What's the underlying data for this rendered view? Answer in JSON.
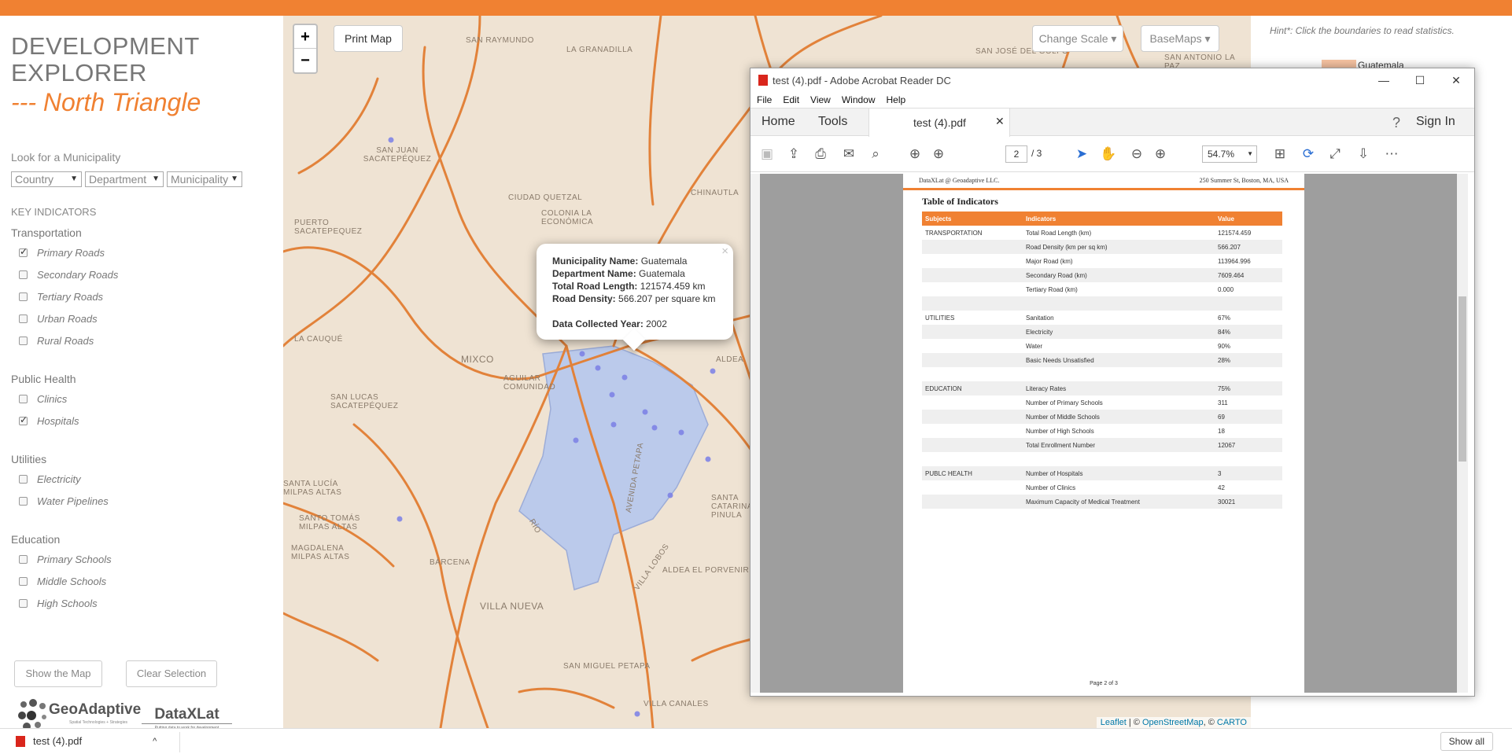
{
  "sidebar": {
    "title_line1": "DEVELOPMENT",
    "title_line2": "EXPLORER",
    "subtitle": "--- North Triangle",
    "search_label": "Look for a Municipality",
    "selects": [
      "Country",
      "Department",
      "Municipality"
    ],
    "key_indicators": "KEY INDICATORS",
    "sections": [
      {
        "title": "Transportation",
        "items": [
          {
            "label": "Primary Roads",
            "checked": true
          },
          {
            "label": "Secondary Roads",
            "checked": false
          },
          {
            "label": "Tertiary Roads",
            "checked": false
          },
          {
            "label": "Urban Roads",
            "checked": false
          },
          {
            "label": "Rural Roads",
            "checked": false
          }
        ]
      },
      {
        "title": "Public Health",
        "items": [
          {
            "label": "Clinics",
            "checked": false
          },
          {
            "label": "Hospitals",
            "checked": true
          }
        ]
      },
      {
        "title": "Utilities",
        "items": [
          {
            "label": "Electricity",
            "checked": false
          },
          {
            "label": "Water Pipelines",
            "checked": false
          }
        ]
      },
      {
        "title": "Education",
        "items": [
          {
            "label": "Primary Schools",
            "checked": false
          },
          {
            "label": "Middle Schools",
            "checked": false
          },
          {
            "label": "High Schools",
            "checked": false
          }
        ]
      }
    ],
    "show_map": "Show the Map",
    "clear_selection": "Clear Selection",
    "logo_geo": "GeoAdaptive",
    "logo_geo_tag": "Spatial Technologies + Strategies",
    "logo_dx": "DataXLat",
    "logo_dx_tag": "Putting data to work for development"
  },
  "map": {
    "zoom_in": "+",
    "zoom_out": "−",
    "print": "Print Map",
    "change_scale": "Change Scale ▾",
    "basemaps": "BaseMaps ▾",
    "labels": [
      "SAN RAYMUNDO",
      "LA GRANADILLA",
      "SAN JOSÉ DEL GOLFO",
      "SAN ANTONIO LA PAZ",
      "SAN JUAN SACATEPÉQUEZ",
      "CIUDAD QUETZAL",
      "COLONIA LA ECONÓMICA",
      "CHINAUTLA",
      "PUERTO SACATEPEQUEZ",
      "LA CAUQUÉ",
      "MIXCO",
      "AGUILAR COMUNIDAD",
      "SAN LUCAS SACATEPÉQUEZ",
      "SANTA LUCÍA MILPAS ALTAS",
      "SANTO TOMÁS MILPAS ALTAS",
      "MAGDALENA MILPAS ALTAS",
      "BÁRCENA",
      "VILLA NUEVA",
      "ALDEA EL PORVENIR",
      "SAN MIGUEL PETAPA",
      "VILLA CANALES",
      "ALDEA",
      "SANTA CATARINA PINULA",
      "AVENIDA PETAPA",
      "VILLA LOBOS",
      "RÍO"
    ],
    "attribution_leaflet": "Leaflet",
    "attribution_osm": "OpenStreetMap",
    "attribution_carto": "CARTO",
    "popup": {
      "muni_label": "Municipality Name:",
      "muni": "Guatemala",
      "dept_label": "Department Name:",
      "dept": "Guatemala",
      "road_label": "Total Road Length:",
      "road": "121574.459 km",
      "density_label": "Road Density:",
      "density": "566.207 per square km",
      "year_label": "Data Collected Year:",
      "year": "2002"
    }
  },
  "right": {
    "hint": "Hint*: Click the boundaries to read statistics.",
    "legend": "Guatemala"
  },
  "acrobat": {
    "title": "test (4).pdf - Adobe Acrobat Reader DC",
    "menu": [
      "File",
      "Edit",
      "View",
      "Window",
      "Help"
    ],
    "home": "Home",
    "tools": "Tools",
    "doc_tab": "test (4).pdf",
    "sign_in": "Sign In",
    "page_current": "2",
    "page_total": "/ 3",
    "zoom": "54.7%",
    "pdf": {
      "org": "DataXLat @ Geoadaptive LLC.",
      "address": "250 Summer St, Boston, MA, USA",
      "heading": "Table of Indicators",
      "cols": [
        "Subjects",
        "Indicators",
        "Value"
      ],
      "rows": [
        [
          "TRANSPORTATION",
          "Total Road Length (km)",
          "121574.459"
        ],
        [
          "",
          "Road Density (km per sq km)",
          "566.207"
        ],
        [
          "",
          "Major Road (km)",
          "113964.996"
        ],
        [
          "",
          "Secondary Road (km)",
          "7609.464"
        ],
        [
          "",
          "Tertiary Road (km)",
          "0.000"
        ],
        [
          "",
          "",
          ""
        ],
        [
          "UTILITIES",
          "Sanitation",
          "67%"
        ],
        [
          "",
          "Electricity",
          "84%"
        ],
        [
          "",
          "Water",
          "90%"
        ],
        [
          "",
          "Basic Needs Unsatisfied",
          "28%"
        ],
        [
          "",
          "",
          ""
        ],
        [
          "EDUCATION",
          "Literacy Rates",
          "75%"
        ],
        [
          "",
          "Number of Primary Schools",
          "311"
        ],
        [
          "",
          "Number of Middle Schools",
          "69"
        ],
        [
          "",
          "Number of High Schools",
          "18"
        ],
        [
          "",
          "Total Enrollment Number",
          "12067"
        ],
        [
          "",
          "",
          ""
        ],
        [
          "PUBLC HEALTH",
          "Number of Hospitals",
          "3"
        ],
        [
          "",
          "Number of Clinics",
          "42"
        ],
        [
          "",
          "Maximum Capacity of Medical Treatment",
          "30021"
        ]
      ],
      "footer": "Page 2 of 3"
    }
  },
  "downloads": {
    "file": "test (4).pdf",
    "show_all": "Show all"
  }
}
